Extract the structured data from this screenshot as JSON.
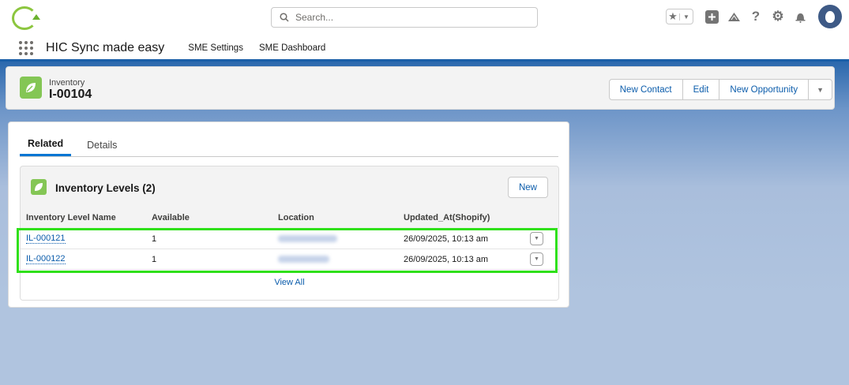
{
  "header": {
    "search_placeholder": "Search..."
  },
  "nav": {
    "app_name": "HIC Sync made easy",
    "items": [
      "SME Settings",
      "SME Dashboard"
    ]
  },
  "record": {
    "object_type": "Inventory",
    "title": "I-00104",
    "actions": [
      "New Contact",
      "Edit",
      "New Opportunity"
    ]
  },
  "tabs": [
    "Related",
    "Details"
  ],
  "related_list": {
    "title": "Inventory Levels (2)",
    "new_label": "New",
    "columns": [
      "Inventory Level Name",
      "Available",
      "Location",
      "Updated_At(Shopify)"
    ],
    "rows": [
      {
        "name": "IL-000121",
        "available": "1",
        "updated": "26/09/2025, 10:13 am"
      },
      {
        "name": "IL-000122",
        "available": "1",
        "updated": "26/09/2025, 10:13 am"
      }
    ],
    "view_all": "View All"
  },
  "colors": {
    "accent": "#0176d3",
    "highlight": "#2fe01a",
    "object_icon": "#84c655"
  }
}
